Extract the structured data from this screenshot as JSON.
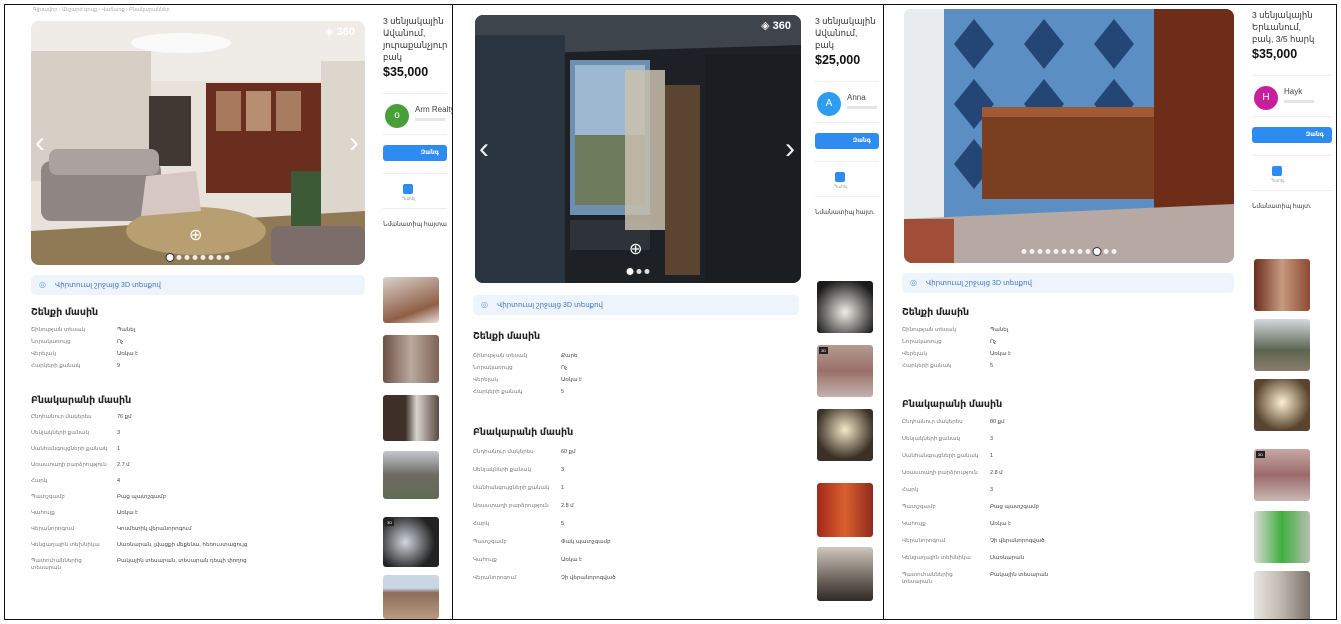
{
  "panels": [
    {
      "id": "p1",
      "breadcrumb": "Գլխավոր › Անշարժ գույք › Վաճառք › Բնակարաններ",
      "title_lines": "3 սենյակային\nԱվանում,\nյուրաքանչյուր\nբակ",
      "price": "$35,000",
      "agent_initial": "o",
      "agent_name": "Arm Realty",
      "agent_color": "#4a9e3a",
      "call_label": "Զանգ",
      "save_label": "Պահել",
      "similar_label": "Նմանատիպ հայտարարություններ",
      "tour_label": "Վիրտուալ շրջայց 3D տեսքով",
      "section_building": "Շենքի մասին",
      "building_rows": [
        [
          "Շինության տեսակ",
          "Պանել"
        ],
        [
          "Նորակառույց",
          "Ոչ"
        ],
        [
          "Վերելակ",
          "Առկա է"
        ],
        [
          "Հարկերի քանակ",
          "9"
        ]
      ],
      "section_apartment": "Բնակարանի մասին",
      "apartment_rows": [
        [
          "Ընդհանուր մակերես",
          "76 քմ"
        ],
        [
          "Սենյակների քանակ",
          "3"
        ],
        [
          "Սանհանգույցների քանակ",
          "1"
        ],
        [
          "Առաստաղի բարձրություն",
          "2.7 մ"
        ],
        [
          "Հարկ",
          "4"
        ],
        [
          "Պատշգամբ",
          "Բաց պատշգամբ"
        ],
        [
          "Կահույք",
          "Առկա է"
        ],
        [
          "Վերանորոգում",
          "Կոսմետիկ վերանորոգում"
        ],
        [
          "Կենցաղային տեխնիկա",
          "Սառնարան, լվացքի մեքենա, հեռուստացույց"
        ],
        [
          "Պատուհաններից տեսարան",
          "Բակային տեսարան, տեսարան դեպի փողոց"
        ]
      ],
      "dots": 8,
      "active_dot": 0,
      "pano": "360"
    },
    {
      "id": "p2",
      "breadcrumb": "",
      "title_lines": "3 սենյակային\nԱվանում,\nբակ",
      "price": "$25,000",
      "agent_initial": "A",
      "agent_name": "Anna",
      "agent_color": "#2e9cf0",
      "call_label": "Զանգ",
      "save_label": "Պահել",
      "similar_label": "Նմանատիպ հայտ.",
      "tour_label": "Վիրտուալ շրջայց 3D տեսքով",
      "section_building": "Շենքի մասին",
      "building_rows": [
        [
          "Շինության տեսակ",
          "Քարե"
        ],
        [
          "Նորակառույց",
          "Ոչ"
        ],
        [
          "Վերելակ",
          "Առկա է"
        ],
        [
          "Հարկերի քանակ",
          "5"
        ]
      ],
      "section_apartment": "Բնակարանի մասին",
      "apartment_rows": [
        [
          "Ընդհանուր մակերես",
          "60 քմ"
        ],
        [
          "Սենյակների քանակ",
          "3"
        ],
        [
          "Սանհանգույցների քանակ",
          "1"
        ],
        [
          "Առաստաղի բարձրություն",
          "2.8 մ"
        ],
        [
          "Հարկ",
          "5"
        ],
        [
          "Պատշգամբ",
          "Փակ պատշգամբ"
        ],
        [
          "Կահույք",
          "Առկա է"
        ],
        [
          "Վերանորոգում",
          "Չի վերանորոգված"
        ]
      ],
      "dots": 3,
      "active_dot": 0,
      "pano": "360"
    },
    {
      "id": "p3",
      "breadcrumb": "",
      "title_lines": "3 սենյակային\nԵրևանում,\nբակ, 3/5 հարկ",
      "price": "$35,000",
      "agent_initial": "H",
      "agent_name": "Hayk",
      "agent_color": "#c81e9e",
      "call_label": "Զանգ",
      "save_label": "Պահել",
      "similar_label": "Նմանատիպ հայտ.",
      "tour_label": "Վիրտուալ շրջայց 3D տեսքով",
      "section_building": "Շենքի մասին",
      "building_rows": [
        [
          "Շինության տեսակ",
          "Պանել"
        ],
        [
          "Նորակառույց",
          "Ոչ"
        ],
        [
          "Վերելակ",
          "Առկա է"
        ],
        [
          "Հարկերի քանակ",
          "5"
        ]
      ],
      "section_apartment": "Բնակարանի մասին",
      "apartment_rows": [
        [
          "Ընդհանուր մակերես",
          "80 քմ"
        ],
        [
          "Սենյակների քանակ",
          "3"
        ],
        [
          "Սանհանգույցների քանակ",
          "1"
        ],
        [
          "Առաստաղի բարձրություն",
          "2.8 մ"
        ],
        [
          "Հարկ",
          "3"
        ],
        [
          "Պատշգամբ",
          "Բաց պատշգամբ"
        ],
        [
          "Կահույք",
          "Առկա է"
        ],
        [
          "Վերանորոգում",
          "Չի վերանորոգված"
        ],
        [
          "Կենցաղային տեխնիկա",
          "Սառնարան"
        ],
        [
          "Պատուհաններից տեսարան",
          "Բակային տեսարան"
        ]
      ],
      "dots": 12,
      "active_dot": 9,
      "pano": ""
    }
  ],
  "icons": {
    "prev": "chevron-left-icon",
    "next": "chevron-right-icon",
    "zoom": "zoom-in-icon",
    "pano": "panorama-360-icon",
    "tour": "tour-3d-icon",
    "save": "bookmark-icon"
  }
}
